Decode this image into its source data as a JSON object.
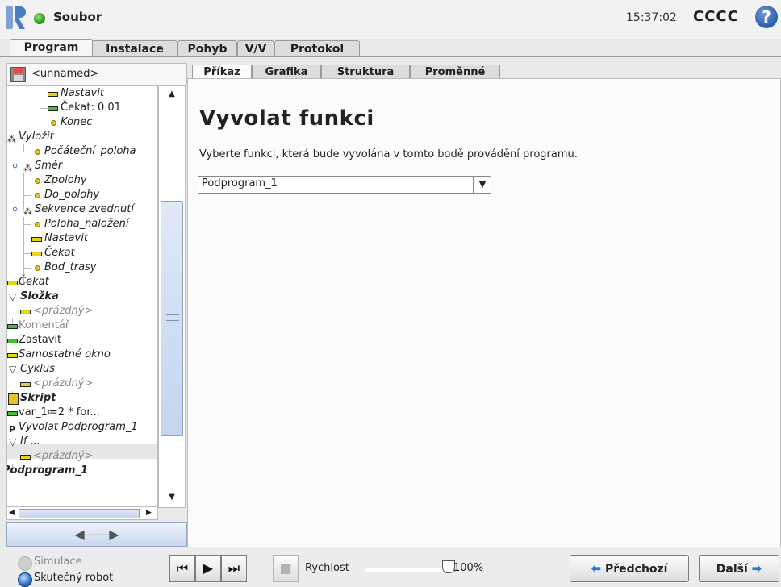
{
  "titlebar": {
    "file_menu": "Soubor",
    "clock": "15:37:02",
    "robot_name": "CCCC",
    "help": "?"
  },
  "main_tabs": [
    "Program",
    "Instalace",
    "Pohyb",
    "V/V",
    "Protokol"
  ],
  "program": {
    "name": "<unnamed>"
  },
  "tree": [
    {
      "label": "Nastavit",
      "icon": "set-icon"
    },
    {
      "label": "Čekat: 0.01",
      "icon": "wait-icon"
    },
    {
      "label": "Konec",
      "icon": "waypoint-icon"
    },
    {
      "label": "Vyložit",
      "icon": "move-icon"
    },
    {
      "label": "Počáteční_poloha",
      "icon": "waypoint-icon"
    },
    {
      "label": "Směr",
      "icon": "move-icon"
    },
    {
      "label": "Zpolohy",
      "icon": "waypoint-icon"
    },
    {
      "label": "Do_polohy",
      "icon": "waypoint-icon"
    },
    {
      "label": "Sekvence zvednutí",
      "icon": "move-icon"
    },
    {
      "label": "Poloha_naložení",
      "icon": "waypoint-icon"
    },
    {
      "label": "Nastavit",
      "icon": "set-icon"
    },
    {
      "label": "Čekat",
      "icon": "wait-icon"
    },
    {
      "label": "Bod_trasy",
      "icon": "waypoint-icon"
    },
    {
      "label": "Čekat",
      "icon": "wait-icon"
    },
    {
      "label": "Složka",
      "icon": "folder-icon"
    },
    {
      "label": "<prázdný>",
      "icon": "set-icon"
    },
    {
      "label": "Komentář",
      "icon": "comment-icon"
    },
    {
      "label": "Zastavit",
      "icon": "halt-icon"
    },
    {
      "label": "Samostatné okno",
      "icon": "popup-icon"
    },
    {
      "label": "Cyklus",
      "icon": "loop-icon"
    },
    {
      "label": "<prázdný>",
      "icon": "set-icon"
    },
    {
      "label": "Skript",
      "icon": "script-icon"
    },
    {
      "label": "var_1≔2 * for...",
      "icon": "assignment-icon"
    },
    {
      "label": "Vyvolat Podprogram_1",
      "icon": "call-icon"
    },
    {
      "label": "If ...",
      "icon": "if-icon"
    },
    {
      "label": "<prázdný>",
      "icon": "set-icon"
    },
    {
      "label": "Podprogram_1",
      "icon": "subprogram-icon"
    }
  ],
  "command_tabs": [
    "Příkaz",
    "Grafika",
    "Struktura",
    "Proměnné"
  ],
  "command": {
    "heading": "Vyvolat funkci",
    "description": "Vyberte funkci, která bude vyvolána v tomto bodě provádění programu.",
    "selected_function": "Podprogram_1"
  },
  "bottom": {
    "mode_simulation": "Simulace",
    "mode_real": "Skutečný robot",
    "speed_label": "Rychlost",
    "speed_value": "100%",
    "speed_fraction": 1.0,
    "prev_label": "Předchozí",
    "next_label": "Další"
  },
  "colors": {
    "accent_blue": "#2e74d1",
    "status_green": "#2e9a1c",
    "waypoint_yellow": "#e7c21e"
  }
}
